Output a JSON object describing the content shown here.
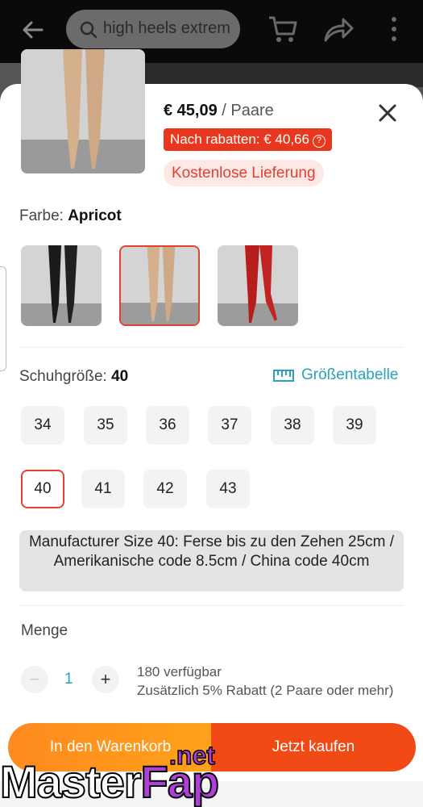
{
  "appbar": {
    "search_placeholder": "high heels extrem",
    "icons": [
      "back-arrow-icon",
      "search-icon",
      "cart-icon",
      "share-icon",
      "more-icon"
    ]
  },
  "product": {
    "price": "€ 45,09",
    "unit": "/ Paare",
    "discount_label": "Nach rabatten: € 40,66",
    "discount_info": "?",
    "shipping": "Kostenlose Lieferung"
  },
  "color": {
    "label": "Farbe:",
    "selected": "Apricot",
    "options": [
      "black",
      "apricot",
      "red"
    ]
  },
  "size": {
    "label": "Schuhgröße:",
    "selected": "40",
    "size_table": "Größentabelle",
    "options": [
      "34",
      "35",
      "36",
      "37",
      "38",
      "39",
      "40",
      "41",
      "42",
      "43"
    ],
    "info": "Manufacturer Size 40: Ferse bis zu den Zehen 25cm / Amerikanische code 8.5cm / China code 40cm"
  },
  "quantity": {
    "label": "Menge",
    "minus": "−",
    "value": "1",
    "plus": "+",
    "available": "180 verfügbar",
    "bulk_discount": "Zusätzlich 5% Rabatt (2 Paare oder mehr)"
  },
  "actions": {
    "add_to_cart": "In den Warenkorb",
    "buy_now": "Jetzt kaufen"
  },
  "watermark": {
    "part1": "Master",
    "part2": "Fap",
    "suffix": ".net"
  },
  "colors": {
    "accent_red": "#e24130",
    "teal": "#2aa2b8",
    "orange": "#ff8a1f",
    "buy_orange": "#f24a14"
  }
}
